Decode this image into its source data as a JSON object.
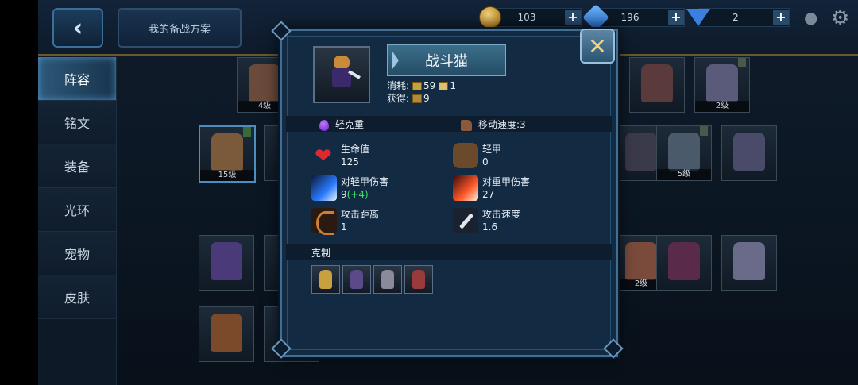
{
  "topbar": {
    "plan_button": "我的备战方案",
    "gold": "103",
    "gems": "196",
    "diamonds": "2",
    "plus": "+",
    "back_icon": "‹"
  },
  "sidebar": {
    "items": [
      {
        "label": "阵容",
        "active": true
      },
      {
        "label": "铭文"
      },
      {
        "label": "装备"
      },
      {
        "label": "光环"
      },
      {
        "label": "宠物"
      },
      {
        "label": "皮肤"
      }
    ]
  },
  "grid": {
    "levels": [
      "4级",
      "2级",
      "15级",
      "5级",
      "2级"
    ]
  },
  "modal": {
    "name": "战斗猫",
    "cost_label": "消耗:",
    "cost_value_1": "59",
    "cost_value_2": "1",
    "gain_label": "获得:",
    "gain_value": "9",
    "armor_type": "轻克重",
    "move_speed": "移动速度:3",
    "stats": [
      {
        "label": "生命值",
        "value": "125",
        "icon": "heart-icon"
      },
      {
        "label": "轻甲",
        "value": "0",
        "icon": "light-armor-icon"
      },
      {
        "label": "对轻甲伤害",
        "value": "9",
        "bonus": "(+4)",
        "icon": "blue-slash-icon"
      },
      {
        "label": "对重甲伤害",
        "value": "27",
        "icon": "red-slash-icon"
      },
      {
        "label": "攻击距离",
        "value": "1",
        "icon": "bow-icon"
      },
      {
        "label": "攻击速度",
        "value": "1.6",
        "icon": "dagger-icon"
      }
    ],
    "counter_label": "克制",
    "close_icon": "✕"
  },
  "colors": {
    "accent": "#3f6f94",
    "gold": "#f2d27a",
    "bonus_green": "#3ee06b",
    "heart": "#e0282e"
  }
}
